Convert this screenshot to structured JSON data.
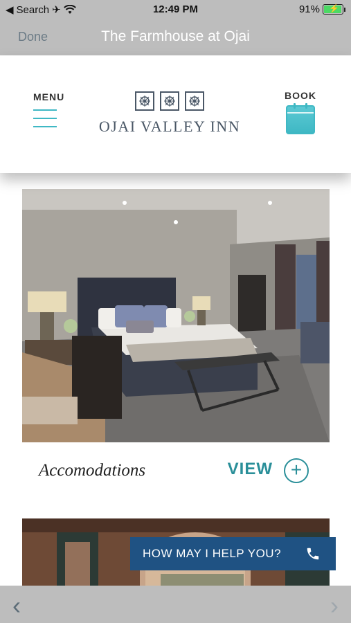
{
  "status_bar": {
    "back_app": "Search",
    "time": "12:49 PM",
    "battery": "91%"
  },
  "nav": {
    "done_label": "Done",
    "title": "The Farmhouse at Ojai"
  },
  "header": {
    "menu_label": "MENU",
    "logo_text": "OJAI VALLEY INN",
    "book_label": "BOOK"
  },
  "cards": [
    {
      "caption": "Accomodations",
      "view_label": "VIEW",
      "plus_icon": "+"
    }
  ],
  "help": {
    "label": "HOW MAY I HELP YOU?",
    "icon": "phone-icon"
  },
  "toolbar": {
    "back_icon": "‹",
    "forward_icon": "›"
  },
  "colors": {
    "accent": "#2a8f99",
    "teal_light": "#3fb8c4",
    "navy": "#1f5283",
    "chrome_gray": "#bdbdbd",
    "logo_slate": "#4a5766"
  }
}
